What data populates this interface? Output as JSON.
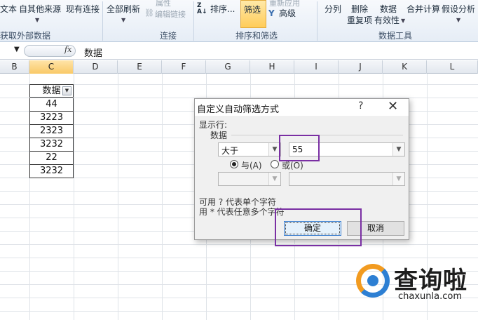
{
  "ribbon": {
    "get_external_data": {
      "text_btn": "文本",
      "other_sources_btn": "自其他来源",
      "existing_conn_btn": "现有连接",
      "group_label": "获取外部数据"
    },
    "connections": {
      "refresh_all_btn": "全部刷新",
      "properties_btn": "属性",
      "edit_links_btn": "编辑链接",
      "group_label": "连接"
    },
    "sort_filter": {
      "sort_btn": "排序...",
      "filter_btn": "筛选",
      "reapply_btn": "重新应用",
      "advanced_btn": "高级",
      "group_label": "排序和筛选"
    },
    "data_tools": {
      "text_to_columns_btn": "分列",
      "remove_dup_line1": "删除",
      "remove_dup_line2": "重复项",
      "validation_line1": "数据",
      "validation_line2": "有效性",
      "consolidate_btn": "合并计算",
      "whatif_btn": "假设分析",
      "group_label": "数据工具"
    }
  },
  "formula_bar": {
    "content": "数据",
    "fx_label": "fx"
  },
  "columns": [
    "B",
    "C",
    "D",
    "E",
    "F",
    "G",
    "H",
    "I",
    "J",
    "K",
    "L"
  ],
  "table": {
    "header": "数据",
    "values": [
      "44",
      "3223",
      "2323",
      "3232",
      "22",
      "3232"
    ]
  },
  "dialog": {
    "title": "自定义自动筛选方式",
    "help": "?",
    "close": "✕",
    "show_rows_label": "显示行:",
    "field_label": "数据",
    "condition1_operator": "大于",
    "condition1_value": "55",
    "and_label": "与(A)",
    "or_label": "或(O)",
    "hint1": "可用 ? 代表单个字符",
    "hint2": "用 * 代表任意多个字符",
    "ok": "确定",
    "cancel": "取消"
  },
  "watermark": {
    "title": "查询啦",
    "url": "chaxunla.com"
  },
  "colors": {
    "highlight": "#7a2fa3",
    "active_header": "#f9c967",
    "logo_orange": "#f29b20",
    "logo_blue": "#2d7fd3"
  }
}
